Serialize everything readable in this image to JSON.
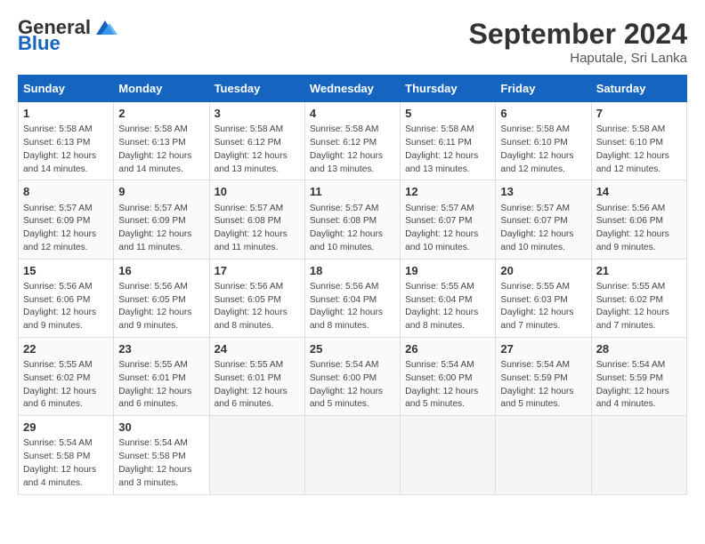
{
  "header": {
    "logo_general": "General",
    "logo_blue": "Blue",
    "month_title": "September 2024",
    "subtitle": "Haputale, Sri Lanka"
  },
  "days_of_week": [
    "Sunday",
    "Monday",
    "Tuesday",
    "Wednesday",
    "Thursday",
    "Friday",
    "Saturday"
  ],
  "weeks": [
    [
      {
        "day": "1",
        "info": "Sunrise: 5:58 AM\nSunset: 6:13 PM\nDaylight: 12 hours\nand 14 minutes."
      },
      {
        "day": "2",
        "info": "Sunrise: 5:58 AM\nSunset: 6:13 PM\nDaylight: 12 hours\nand 14 minutes."
      },
      {
        "day": "3",
        "info": "Sunrise: 5:58 AM\nSunset: 6:12 PM\nDaylight: 12 hours\nand 13 minutes."
      },
      {
        "day": "4",
        "info": "Sunrise: 5:58 AM\nSunset: 6:12 PM\nDaylight: 12 hours\nand 13 minutes."
      },
      {
        "day": "5",
        "info": "Sunrise: 5:58 AM\nSunset: 6:11 PM\nDaylight: 12 hours\nand 13 minutes."
      },
      {
        "day": "6",
        "info": "Sunrise: 5:58 AM\nSunset: 6:10 PM\nDaylight: 12 hours\nand 12 minutes."
      },
      {
        "day": "7",
        "info": "Sunrise: 5:58 AM\nSunset: 6:10 PM\nDaylight: 12 hours\nand 12 minutes."
      }
    ],
    [
      {
        "day": "8",
        "info": "Sunrise: 5:57 AM\nSunset: 6:09 PM\nDaylight: 12 hours\nand 12 minutes."
      },
      {
        "day": "9",
        "info": "Sunrise: 5:57 AM\nSunset: 6:09 PM\nDaylight: 12 hours\nand 11 minutes."
      },
      {
        "day": "10",
        "info": "Sunrise: 5:57 AM\nSunset: 6:08 PM\nDaylight: 12 hours\nand 11 minutes."
      },
      {
        "day": "11",
        "info": "Sunrise: 5:57 AM\nSunset: 6:08 PM\nDaylight: 12 hours\nand 10 minutes."
      },
      {
        "day": "12",
        "info": "Sunrise: 5:57 AM\nSunset: 6:07 PM\nDaylight: 12 hours\nand 10 minutes."
      },
      {
        "day": "13",
        "info": "Sunrise: 5:57 AM\nSunset: 6:07 PM\nDaylight: 12 hours\nand 10 minutes."
      },
      {
        "day": "14",
        "info": "Sunrise: 5:56 AM\nSunset: 6:06 PM\nDaylight: 12 hours\nand 9 minutes."
      }
    ],
    [
      {
        "day": "15",
        "info": "Sunrise: 5:56 AM\nSunset: 6:06 PM\nDaylight: 12 hours\nand 9 minutes."
      },
      {
        "day": "16",
        "info": "Sunrise: 5:56 AM\nSunset: 6:05 PM\nDaylight: 12 hours\nand 9 minutes."
      },
      {
        "day": "17",
        "info": "Sunrise: 5:56 AM\nSunset: 6:05 PM\nDaylight: 12 hours\nand 8 minutes."
      },
      {
        "day": "18",
        "info": "Sunrise: 5:56 AM\nSunset: 6:04 PM\nDaylight: 12 hours\nand 8 minutes."
      },
      {
        "day": "19",
        "info": "Sunrise: 5:55 AM\nSunset: 6:04 PM\nDaylight: 12 hours\nand 8 minutes."
      },
      {
        "day": "20",
        "info": "Sunrise: 5:55 AM\nSunset: 6:03 PM\nDaylight: 12 hours\nand 7 minutes."
      },
      {
        "day": "21",
        "info": "Sunrise: 5:55 AM\nSunset: 6:02 PM\nDaylight: 12 hours\nand 7 minutes."
      }
    ],
    [
      {
        "day": "22",
        "info": "Sunrise: 5:55 AM\nSunset: 6:02 PM\nDaylight: 12 hours\nand 6 minutes."
      },
      {
        "day": "23",
        "info": "Sunrise: 5:55 AM\nSunset: 6:01 PM\nDaylight: 12 hours\nand 6 minutes."
      },
      {
        "day": "24",
        "info": "Sunrise: 5:55 AM\nSunset: 6:01 PM\nDaylight: 12 hours\nand 6 minutes."
      },
      {
        "day": "25",
        "info": "Sunrise: 5:54 AM\nSunset: 6:00 PM\nDaylight: 12 hours\nand 5 minutes."
      },
      {
        "day": "26",
        "info": "Sunrise: 5:54 AM\nSunset: 6:00 PM\nDaylight: 12 hours\nand 5 minutes."
      },
      {
        "day": "27",
        "info": "Sunrise: 5:54 AM\nSunset: 5:59 PM\nDaylight: 12 hours\nand 5 minutes."
      },
      {
        "day": "28",
        "info": "Sunrise: 5:54 AM\nSunset: 5:59 PM\nDaylight: 12 hours\nand 4 minutes."
      }
    ],
    [
      {
        "day": "29",
        "info": "Sunrise: 5:54 AM\nSunset: 5:58 PM\nDaylight: 12 hours\nand 4 minutes."
      },
      {
        "day": "30",
        "info": "Sunrise: 5:54 AM\nSunset: 5:58 PM\nDaylight: 12 hours\nand 3 minutes."
      },
      {
        "day": "",
        "info": ""
      },
      {
        "day": "",
        "info": ""
      },
      {
        "day": "",
        "info": ""
      },
      {
        "day": "",
        "info": ""
      },
      {
        "day": "",
        "info": ""
      }
    ]
  ]
}
